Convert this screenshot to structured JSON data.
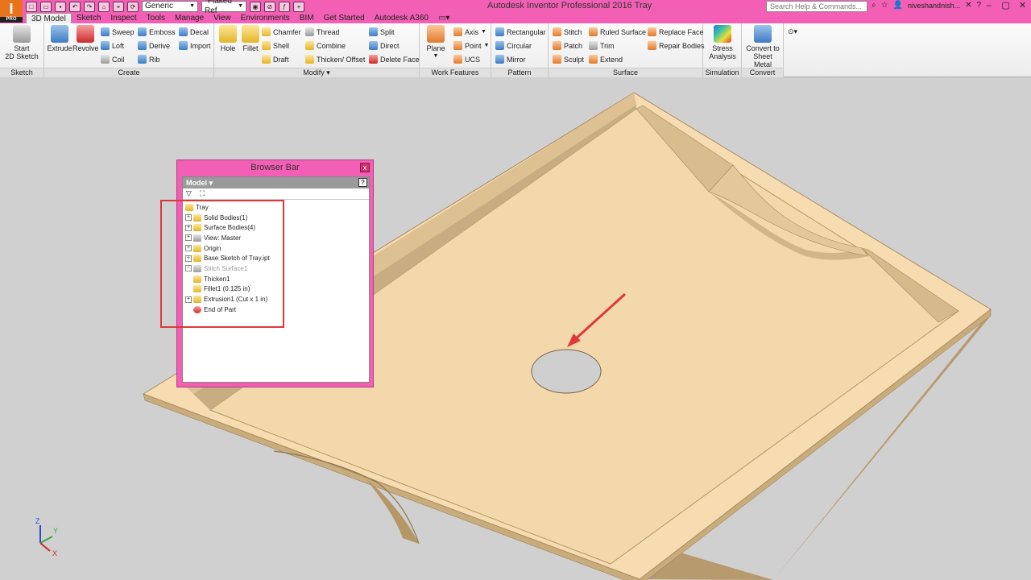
{
  "app": {
    "logo_letter": "I",
    "logo_sub": "PRO",
    "title": "Autodesk Inventor Professional 2016    Tray",
    "material_combo": "Generic",
    "appearance_combo": "*Flaked Ref",
    "search_placeholder": "Search Help & Commands...",
    "user": "niveshandnish...",
    "colors": {
      "title_bar": "#f25fb4",
      "browser_frame": "#f25fb4",
      "part": "#f6dcb0",
      "annotation": "#e0383a"
    }
  },
  "tabs": [
    "3D Model",
    "Sketch",
    "Inspect",
    "Tools",
    "Manage",
    "View",
    "Environments",
    "BIM",
    "Get Started",
    "Autodesk A360"
  ],
  "ribbon": {
    "sketch": {
      "label": "Sketch",
      "start_line1": "Start",
      "start_line2": "2D Sketch"
    },
    "create": {
      "label": "Create",
      "extrude": "Extrude",
      "revolve": "Revolve",
      "sweep": "Sweep",
      "loft": "Loft",
      "coil": "Coil",
      "emboss": "Emboss",
      "derive": "Derive",
      "rib": "Rib",
      "decal": "Decal",
      "import": "Import"
    },
    "modify": {
      "label": "Modify ▾",
      "hole": "Hole",
      "fillet": "Fillet",
      "chamfer": "Chamfer",
      "shell": "Shell",
      "draft": "Draft",
      "thread": "Thread",
      "combine": "Combine",
      "thicken": "Thicken/ Offset",
      "split": "Split",
      "direct": "Direct",
      "delete_face": "Delete Face"
    },
    "work_features": {
      "label": "Work Features",
      "plane": "Plane",
      "axis": "Axis",
      "point": "Point",
      "ucs": "UCS"
    },
    "pattern": {
      "label": "Pattern",
      "rectangular": "Rectangular",
      "circular": "Circular",
      "mirror": "Mirror"
    },
    "surface": {
      "label": "Surface",
      "stitch": "Stitch",
      "patch": "Patch",
      "sculpt": "Sculpt",
      "ruled_surface": "Ruled Surface",
      "trim": "Trim",
      "extend": "Extend",
      "replace_face": "Replace Face",
      "repair_bodies": "Repair Bodies"
    },
    "simulation": {
      "label": "Simulation",
      "stress_line1": "Stress",
      "stress_line2": "Analysis"
    },
    "convert": {
      "label": "Convert",
      "line1": "Convert to",
      "line2": "Sheet Metal"
    }
  },
  "browser": {
    "title": "Browser Bar",
    "close": "x",
    "model_dropdown": "Model ▾",
    "help": "?",
    "tree": [
      {
        "label": "Tray",
        "icon": "part-icon"
      },
      {
        "label": "Solid Bodies(1)",
        "icon": "folder-icon"
      },
      {
        "label": "Surface Bodies(4)",
        "icon": "folder-icon"
      },
      {
        "label": "View: Master",
        "icon": "view-icon"
      },
      {
        "label": "Origin",
        "icon": "folder-icon"
      },
      {
        "label": "Base Sketch of Tray.ipt",
        "icon": "sketch-icon"
      },
      {
        "label": "Stitch Surface1",
        "icon": "stitch-icon"
      },
      {
        "label": "Thicken1",
        "icon": "thicken-icon"
      },
      {
        "label": "Fillet1 (0.125 in)",
        "icon": "fillet-icon"
      },
      {
        "label": "Extrusion1 (Cut x 1 in)",
        "icon": "extrusion-icon"
      },
      {
        "label": "End of Part",
        "icon": "end-of-part-icon"
      }
    ]
  },
  "axes": {
    "x": "X",
    "y": "Y",
    "z": "Z"
  }
}
